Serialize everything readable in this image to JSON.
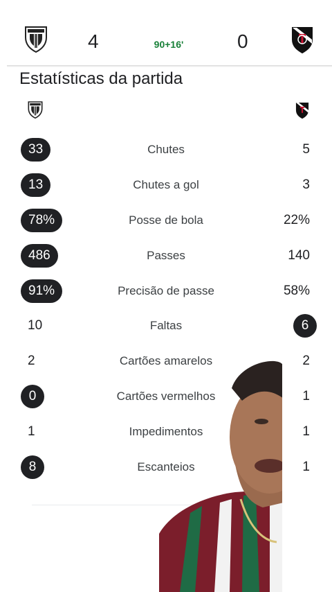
{
  "header": {
    "home_team": {
      "crest_icon": "independiente-del-valle-crest-icon",
      "score": "4"
    },
    "away_team": {
      "crest_icon": "vasco-da-gama-crest-icon",
      "score": "0"
    },
    "clock": "90+16'"
  },
  "section_title": "Estatísticas da partida",
  "stats": [
    {
      "label": "Chutes",
      "home": "33",
      "away": "5",
      "highlight": "home"
    },
    {
      "label": "Chutes a gol",
      "home": "13",
      "away": "3",
      "highlight": "home"
    },
    {
      "label": "Posse de bola",
      "home": "78%",
      "away": "22%",
      "highlight": "home"
    },
    {
      "label": "Passes",
      "home": "486",
      "away": "140",
      "highlight": "home"
    },
    {
      "label": "Precisão de passe",
      "home": "91%",
      "away": "58%",
      "highlight": "home"
    },
    {
      "label": "Faltas",
      "home": "10",
      "away": "6",
      "highlight": "away"
    },
    {
      "label": "Cartões amarelos",
      "home": "2",
      "away": "2",
      "highlight": "none"
    },
    {
      "label": "Cartões vermelhos",
      "home": "0",
      "away": "1",
      "highlight": "home"
    },
    {
      "label": "Impedimentos",
      "home": "1",
      "away": "1",
      "highlight": "none"
    },
    {
      "label": "Escanteios",
      "home": "8",
      "away": "1",
      "highlight": "home"
    }
  ],
  "colors": {
    "pill_bg": "#202124",
    "clock_green": "#188038",
    "home_crest": "#222222",
    "away_crest": "#111111",
    "fluminense_maroon": "#7b1e2b",
    "fluminense_green": "#1f6b45"
  }
}
